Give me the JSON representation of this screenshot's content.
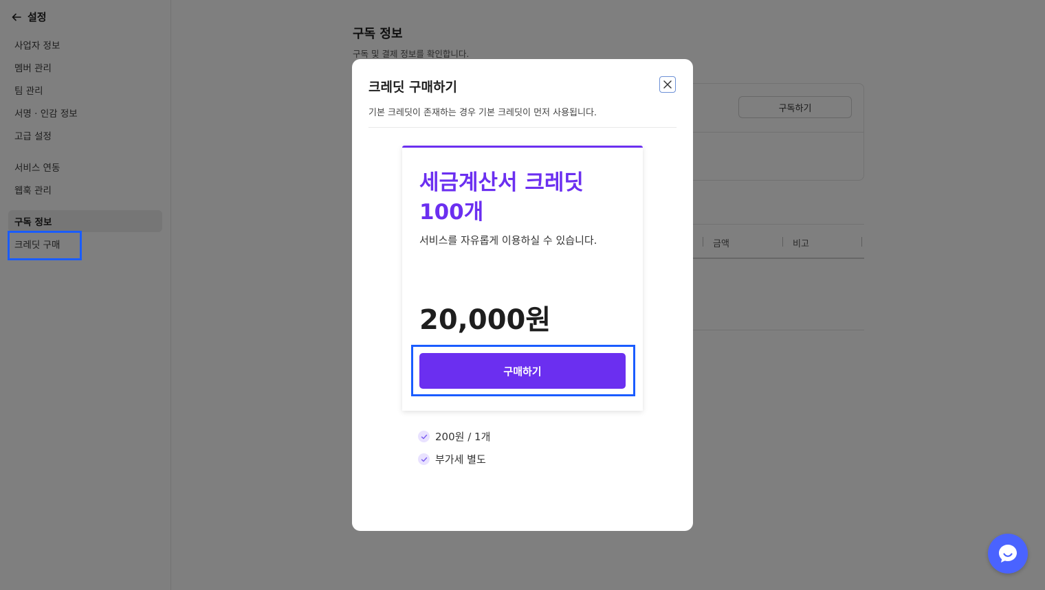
{
  "sidebar": {
    "back_label": "설정",
    "items": [
      {
        "label": "사업자 정보"
      },
      {
        "label": "멤버 관리"
      },
      {
        "label": "팀 관리"
      },
      {
        "label": "서명 · 인감 정보"
      },
      {
        "label": "고급 설정"
      },
      {
        "label": "서비스 연동"
      },
      {
        "label": "웹훅 관리"
      },
      {
        "label": "구독 정보"
      },
      {
        "label": "크레딧 구매"
      }
    ]
  },
  "main": {
    "title": "구독 정보",
    "description": "구독 및 결제 정보를 확인합니다.",
    "subscribe_button": "구독하기",
    "table_headers": [
      "금액",
      "비고"
    ]
  },
  "modal": {
    "title": "크레딧 구매하기",
    "description": "기본 크레딧이 존재하는 경우 기본 크레딧이 먼저 사용됩니다.",
    "product": {
      "name": "세금계산서 크레딧 100개",
      "description": "서비스를 자유롭게 이용하실 수 있습니다.",
      "price": "20,000원",
      "buy_label": "구매하기"
    },
    "features": [
      "200원 / 1개",
      "부가세 별도"
    ]
  },
  "colors": {
    "accent": "#6b2ff0",
    "highlight": "#1a5cff",
    "chat": "#4a63ff"
  }
}
